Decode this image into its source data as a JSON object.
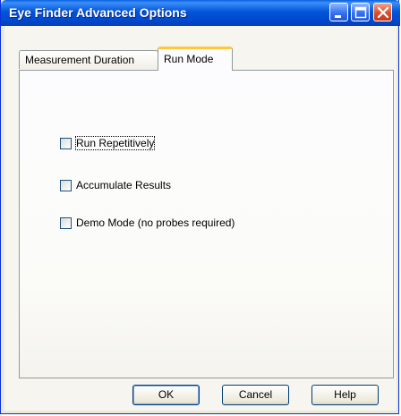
{
  "window": {
    "title": "Eye Finder Advanced Options"
  },
  "title_buttons": {
    "minimize_icon": "minimize-icon",
    "maximize_icon": "maximize-icon",
    "close_icon": "close-icon"
  },
  "tabs": [
    {
      "label": "Measurement Duration",
      "active": false
    },
    {
      "label": "Run Mode",
      "active": true
    }
  ],
  "run_mode": {
    "options": [
      {
        "label": "Run Repetitively",
        "checked": false,
        "focused": true
      },
      {
        "label": "Accumulate Results",
        "checked": false,
        "focused": false
      },
      {
        "label": "Demo Mode (no probes required)",
        "checked": false,
        "focused": false
      }
    ]
  },
  "buttons": {
    "ok": "OK",
    "cancel": "Cancel",
    "help": "Help"
  },
  "colors": {
    "titlebar": "#0255d8",
    "active_tab_accent": "#ffc83c",
    "close_button": "#d9482a"
  }
}
